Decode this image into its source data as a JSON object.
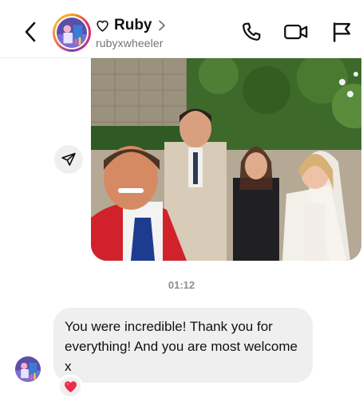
{
  "header": {
    "display_name": "Ruby",
    "username": "rubyxwheeler",
    "back_icon": "chevron-left-icon",
    "call_icon": "phone-icon",
    "video_icon": "video-camera-icon",
    "flag_icon": "flag-icon"
  },
  "photo_message": {
    "share_icon": "paper-plane-icon"
  },
  "timestamp": "01:12",
  "received_message": {
    "text": "You were incredible! Thank you for everything! And you are most welcome x",
    "reaction": "❤️"
  },
  "colors": {
    "bubble": "#efefef",
    "secondary_text": "#737373",
    "reaction_heart": "#ed2b4a"
  }
}
